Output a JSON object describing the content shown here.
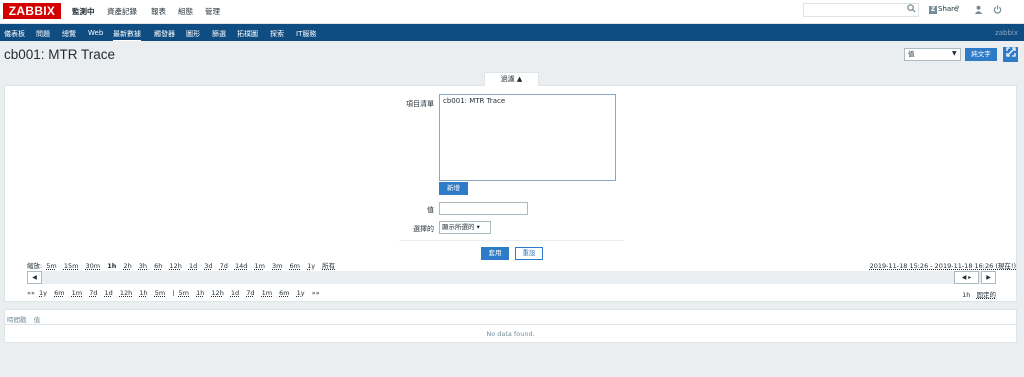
{
  "header": {
    "logo": "ZABBIX",
    "nav": [
      "監測中",
      "資產記錄",
      "報表",
      "組態",
      "管理"
    ],
    "active_nav": "監測中",
    "share_label": "Share",
    "help_icon": "?",
    "user_icon": "user-icon",
    "logout_icon": "power-icon"
  },
  "submenu": {
    "items": [
      "儀表板",
      "問題",
      "總覽",
      "Web",
      "最新數據",
      "觸發器",
      "圖形",
      "篩選",
      "拓樸圖",
      "探索",
      "IT服務"
    ],
    "active": "最新數據",
    "user": "zabbix"
  },
  "page": {
    "title": "cb001: MTR Trace",
    "view_select": "值",
    "plaintext_button": "純文字",
    "fullscreen_icon": "expand-icon"
  },
  "filter": {
    "tab_label": "過濾 ▲",
    "items_label": "項目清單",
    "items": [
      "cb001: MTR Trace"
    ],
    "add_button": "新增",
    "value_label": "值",
    "value": "",
    "selected_label": "選擇的",
    "selected_value": "顯示所選的",
    "apply_button": "套用",
    "reset_button": "重設"
  },
  "time": {
    "zoom_label": "縮放:",
    "zoom": [
      "5m",
      "15m",
      "30m",
      "1h",
      "2h",
      "3h",
      "6h",
      "12h",
      "1d",
      "3d",
      "7d",
      "14d",
      "1m",
      "3m",
      "6m",
      "1y",
      "所有"
    ],
    "zoom_active": "1h",
    "period": "2019-11-18 15:26 - 2019-11-18 16:26 (現在!)",
    "back_arrow": "««",
    "nav_back": [
      "1y",
      "6m",
      "1m",
      "7d",
      "1d",
      "12h",
      "1h",
      "5m"
    ],
    "separator": "|",
    "nav_forward": [
      "5m",
      "1h",
      "12h",
      "1d",
      "7d",
      "1m",
      "6m",
      "1y"
    ],
    "forward_arrow": "»»",
    "duration": "1h",
    "fixed": "固定的"
  },
  "table": {
    "columns": [
      "時間戳",
      "值"
    ],
    "empty": "No data found."
  }
}
